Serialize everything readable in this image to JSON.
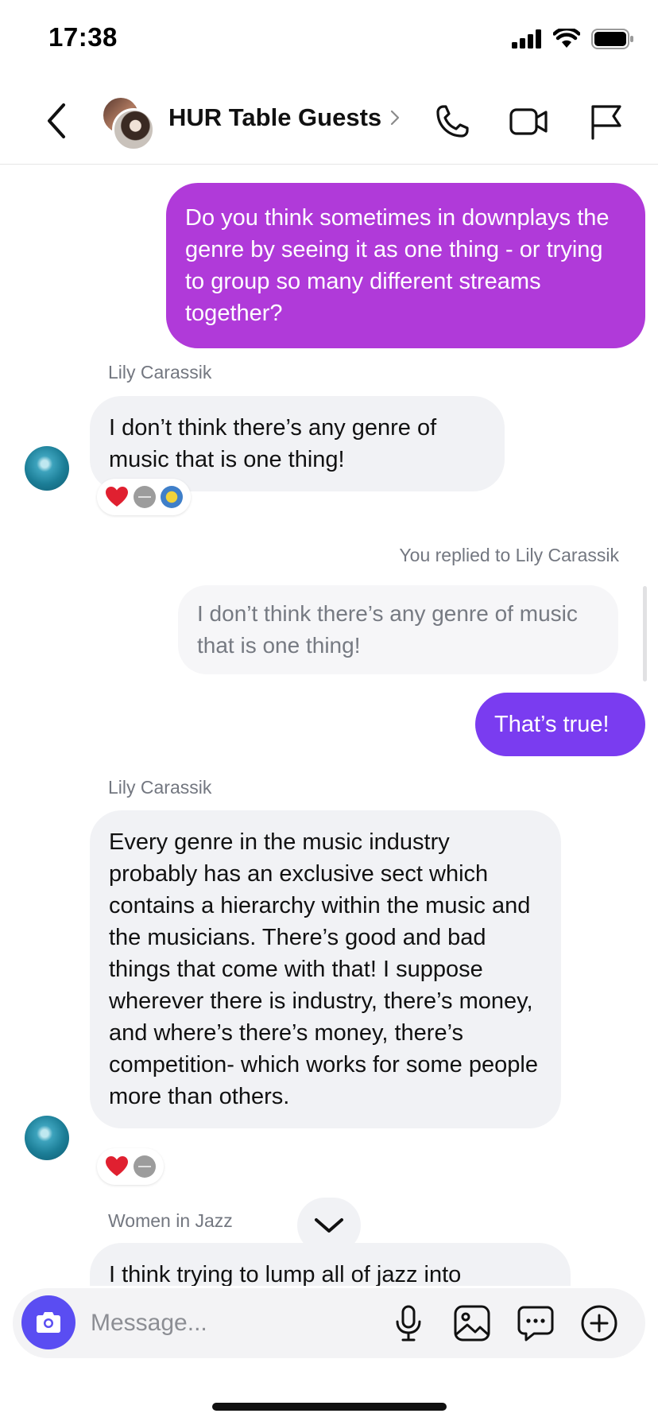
{
  "status": {
    "time": "17:38"
  },
  "header": {
    "title": "HUR Table Guests"
  },
  "messages": {
    "m1": {
      "text": "Do you think sometimes in downplays the genre by seeing it as one thing - or trying to group so many different streams together?"
    },
    "m2": {
      "sender": "Lily Carassik",
      "text": "I don’t think there’s any genre of music that is one thing!"
    },
    "m3": {
      "replied_label": "You replied to Lily Carassik",
      "quote": "I don’t think there’s any genre of music that is one thing!",
      "text": "That’s true!"
    },
    "m4": {
      "sender": "Lily Carassik",
      "text": "Every genre in the music industry probably has an exclusive sect which contains a hierarchy within the music and the musicians. There’s good and bad things that come with that! I suppose wherever there is industry, there’s money, and where’s there’s money, there’s competition- which works for some people more than others."
    },
    "m5": {
      "sender": "Women in Jazz",
      "text": "I think trying to lump all of jazz into"
    }
  },
  "composer": {
    "placeholder": "Message..."
  },
  "colors": {
    "outgoing_purple": "#b03ad9",
    "outgoing_violet": "#7a3cf0",
    "camera_button": "#5a4df2",
    "incoming_bubble": "#f1f2f5"
  }
}
